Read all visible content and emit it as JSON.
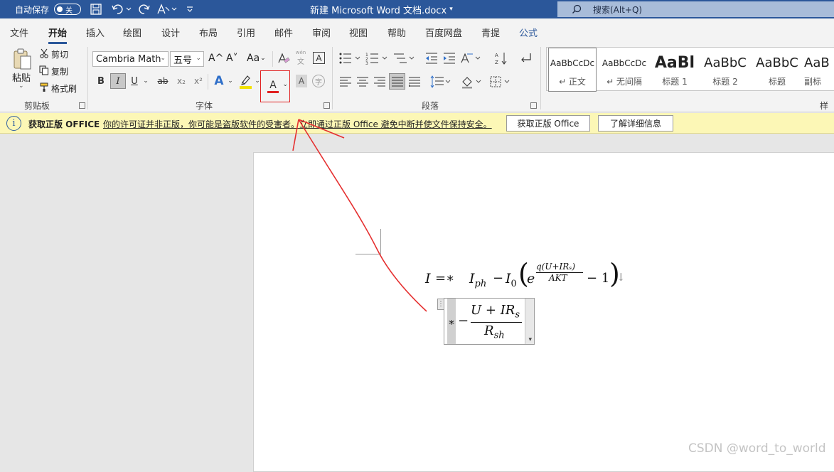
{
  "titlebar": {
    "autosave_label": "自动保存",
    "autosave_state": "关",
    "doc_title": "新建 Microsoft Word 文档.docx",
    "title_caret": "▾",
    "search_placeholder": "搜索(Alt+Q)",
    "icons": [
      "save-icon",
      "undo-icon",
      "redo-icon",
      "format-icon",
      "customize-icon"
    ]
  },
  "tabs": [
    "文件",
    "开始",
    "插入",
    "绘图",
    "设计",
    "布局",
    "引用",
    "邮件",
    "审阅",
    "视图",
    "帮助",
    "百度网盘",
    "青提",
    "公式"
  ],
  "active_tab": "开始",
  "clipboard": {
    "paste": "粘贴",
    "cut": "剪切",
    "copy": "复制",
    "format_painter": "格式刷",
    "group": "剪贴板"
  },
  "font": {
    "name": "Cambria Math",
    "size": "五号",
    "group": "字体",
    "grow": "A^",
    "shrink": "A˅",
    "case": "Aa",
    "bold": "B",
    "italic": "I",
    "underline": "U",
    "strike": "ab",
    "subscript": "x₂",
    "superscript": "x²",
    "font_color_letter": "A",
    "wen": "wén",
    "wen_char": "文",
    "font_color_accent": "#e02020",
    "highlight_accent": "#f2e200"
  },
  "paragraph": {
    "group": "段落"
  },
  "styles": {
    "items": [
      {
        "sample": "AaBbCcDc",
        "name": "↵ 正文"
      },
      {
        "sample": "AaBbCcDc",
        "name": "↵ 无间隔"
      },
      {
        "sample": "AaBl",
        "name": "标题 1"
      },
      {
        "sample": "AaBbC",
        "name": "标题 2"
      },
      {
        "sample": "AaBbC",
        "name": "标题"
      },
      {
        "sample": "AaB",
        "name": "副标"
      }
    ],
    "group": "样式"
  },
  "warning": {
    "icon": "i",
    "title": "获取正版 OFFICE",
    "message": "你的许可证并非正版，你可能是盗版软件的受害者。立即通过正版 Office 避免中断并使文件保持安全。",
    "btn_get": "获取正版 Office",
    "btn_more": "了解详细信息"
  },
  "equation": {
    "line1": {
      "lhs": "I",
      "eq": "=∗",
      "iph": "I",
      "iph_sub": "ph",
      "minus": "−",
      "i0": "I",
      "i0_sub": "0",
      "lparen": "(",
      "e": "e",
      "exp_num": "q(U+IRₛ)",
      "exp_den": "AKT",
      "minus_one": "− 1",
      "rparen": ")",
      "end_mark": "↓"
    },
    "line2": {
      "star": "∗",
      "minus": "−",
      "num": "U + IR",
      "num_sub": "s",
      "den": "R",
      "den_sub": "sh",
      "handle": "⋮",
      "dropdown": "▾"
    }
  },
  "annotation": {
    "color": "#e53030"
  },
  "watermark": "CSDN @word_to_world"
}
